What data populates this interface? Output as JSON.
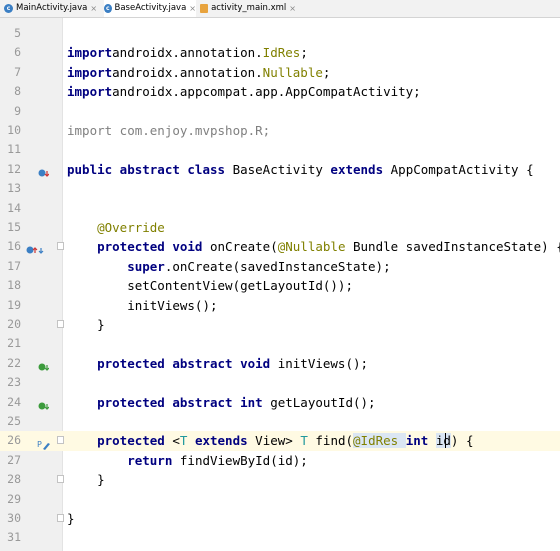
{
  "tabs": [
    {
      "label": "MainActivity.java",
      "icon": "java-class-icon",
      "color": "#3b7fc4",
      "active": false
    },
    {
      "label": "BaseActivity.java",
      "icon": "java-class-icon",
      "color": "#3b7fc4",
      "active": true
    },
    {
      "label": "activity_main.xml",
      "icon": "xml-file-icon",
      "color": "#e8a33d",
      "active": false
    }
  ],
  "tab_close_glyph": "×",
  "lines": [
    {
      "n": "5",
      "segs": []
    },
    {
      "n": "6",
      "segs": [
        [
          "kw",
          "import"
        ],
        [
          "",
          "androidx.annotation."
        ],
        [
          "ann",
          "IdRes"
        ],
        [
          "",
          ";"
        ]
      ]
    },
    {
      "n": "7",
      "segs": [
        [
          "kw",
          "import"
        ],
        [
          "",
          "androidx.annotation."
        ],
        [
          "ann",
          "Nullable"
        ],
        [
          "",
          ";"
        ]
      ]
    },
    {
      "n": "8",
      "segs": [
        [
          "kw",
          "import"
        ],
        [
          "",
          "androidx.appcompat.app.AppCompatActivity;"
        ]
      ]
    },
    {
      "n": "9",
      "segs": []
    },
    {
      "n": "10",
      "segs": [
        [
          "grey",
          "import com.enjoy.mvpshop.R;"
        ]
      ]
    },
    {
      "n": "11",
      "segs": []
    },
    {
      "n": "12",
      "segs": [
        [
          "kw",
          "public abstract class "
        ],
        [
          "",
          "BaseActivity "
        ],
        [
          "kw",
          "extends "
        ],
        [
          "",
          "AppCompatActivity {"
        ]
      ],
      "icon": "override-down-icon"
    },
    {
      "n": "13",
      "segs": []
    },
    {
      "n": "14",
      "segs": []
    },
    {
      "n": "15",
      "segs": [
        [
          "ann",
          "    @Override"
        ]
      ]
    },
    {
      "n": "16",
      "segs": [
        [
          "kw",
          "    protected void "
        ],
        [
          "",
          "onCreate("
        ],
        [
          "ann",
          "@Nullable "
        ],
        [
          "",
          "Bundle savedInstanceState) {"
        ]
      ],
      "icon": "override-up-down-icon",
      "fold": true
    },
    {
      "n": "17",
      "segs": [
        [
          "kw",
          "        super"
        ],
        [
          "",
          ".onCreate(savedInstanceState);"
        ]
      ]
    },
    {
      "n": "18",
      "segs": [
        [
          "",
          "        setContentView(getLayoutId());"
        ]
      ]
    },
    {
      "n": "19",
      "segs": [
        [
          "",
          "        initViews();"
        ]
      ]
    },
    {
      "n": "20",
      "segs": [
        [
          "",
          "    }"
        ]
      ],
      "fold": true
    },
    {
      "n": "21",
      "segs": []
    },
    {
      "n": "22",
      "segs": [
        [
          "kw",
          "    protected abstract void "
        ],
        [
          "",
          "initViews();"
        ]
      ],
      "icon": "implemented-down-icon"
    },
    {
      "n": "23",
      "segs": []
    },
    {
      "n": "24",
      "segs": [
        [
          "kw",
          "    protected abstract int "
        ],
        [
          "",
          "getLayoutId();"
        ]
      ],
      "icon": "implemented-down-icon"
    },
    {
      "n": "25",
      "segs": []
    },
    {
      "n": "26",
      "segs": [
        [
          "kw",
          "    protected "
        ],
        [
          "",
          "<"
        ],
        [
          "typ",
          "T "
        ],
        [
          "kw",
          "extends "
        ],
        [
          "",
          "View> "
        ],
        [
          "typ",
          "T "
        ],
        [
          "",
          "find("
        ],
        [
          "hl ann",
          "@IdRes "
        ],
        [
          "kw",
          "int "
        ],
        [
          "hl",
          "id"
        ],
        [
          "",
          ") {"
        ]
      ],
      "icon": "edit-icon",
      "fold": true,
      "caret": true
    },
    {
      "n": "27",
      "segs": [
        [
          "kw",
          "        return "
        ],
        [
          "",
          "findViewById(id);"
        ]
      ]
    },
    {
      "n": "28",
      "segs": [
        [
          "",
          "    }"
        ]
      ],
      "fold": true
    },
    {
      "n": "29",
      "segs": []
    },
    {
      "n": "30",
      "segs": [
        [
          "",
          "}"
        ]
      ],
      "fold": true
    },
    {
      "n": "31",
      "segs": []
    }
  ]
}
